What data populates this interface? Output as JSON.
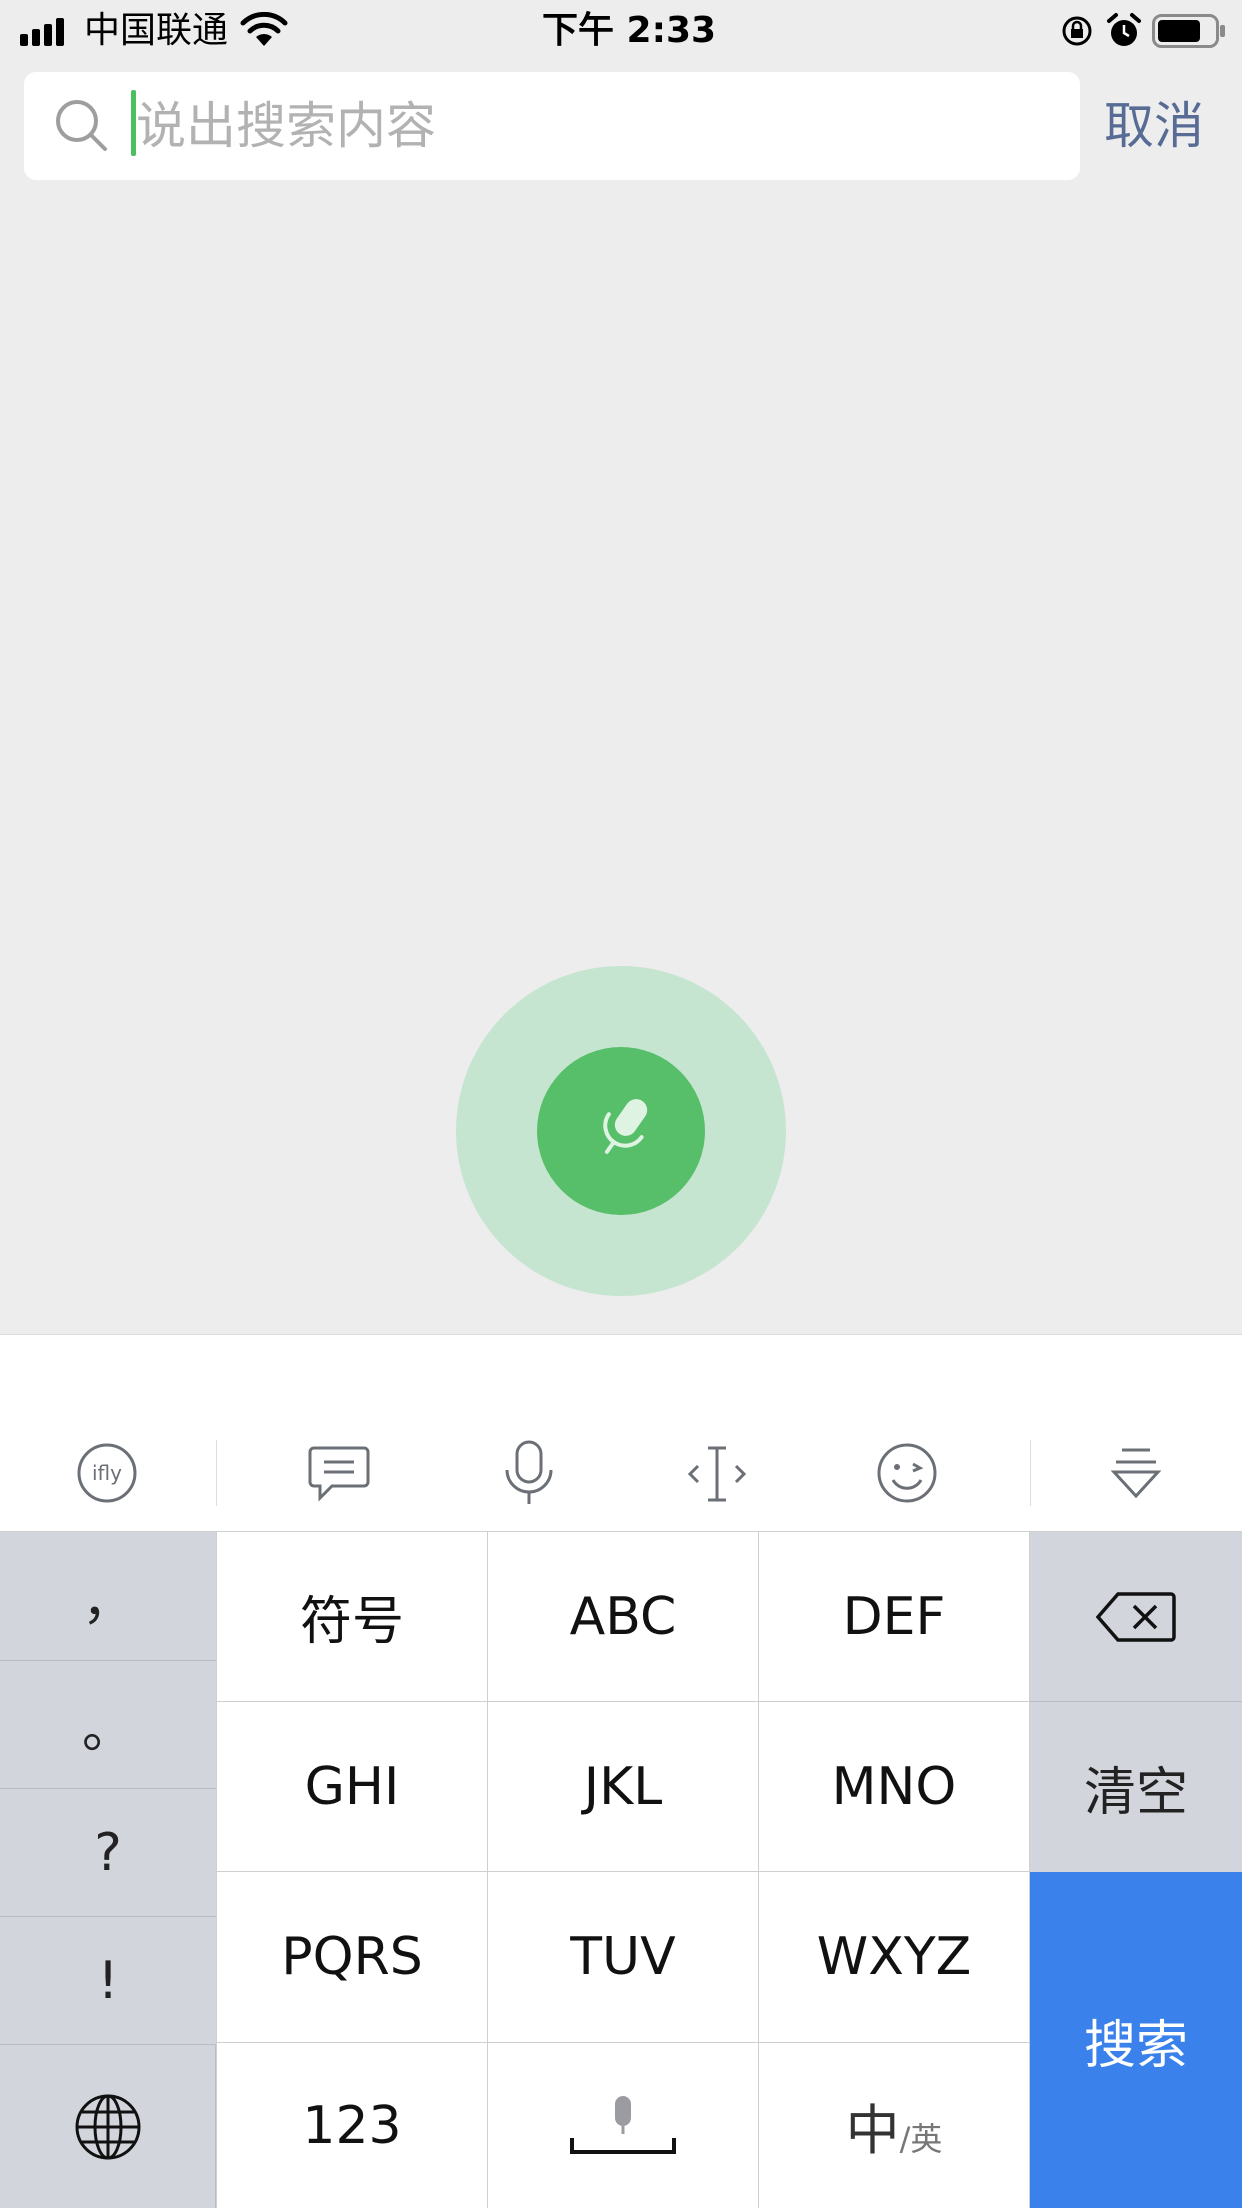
{
  "status_bar": {
    "carrier": "中国联通",
    "time": "下午 2:33"
  },
  "search": {
    "placeholder": "说出搜索内容",
    "cancel_label": "取消"
  },
  "keyboard": {
    "side_keys": [
      "，",
      "。",
      "?",
      "!"
    ],
    "rows": [
      [
        "符号",
        "ABC",
        "DEF"
      ],
      [
        "GHI",
        "JKL",
        "MNO"
      ],
      [
        "PQRS",
        "TUV",
        "WXYZ"
      ]
    ],
    "num_key": "123",
    "lang_main": "中",
    "lang_sub": "英",
    "clear_label": "清空",
    "search_label": "搜索"
  },
  "colors": {
    "accent_green": "#57be6a",
    "search_key_blue": "#3a81eb",
    "link_blue": "#576b95"
  }
}
